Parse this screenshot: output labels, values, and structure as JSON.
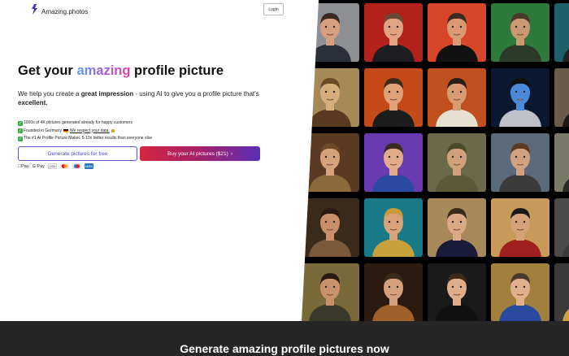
{
  "brand": {
    "name": "Amazing.photos"
  },
  "nav": {
    "login_label": "Login"
  },
  "hero": {
    "headline_before": "Get your ",
    "headline_highlight": "amazing",
    "headline_after": " profile picture",
    "subline_1": "We help you create a ",
    "subline_bold": "great impression",
    "subline_2": " - using AI to give you a profile picture that's ",
    "subline_bold_2": "excellent."
  },
  "bullets": {
    "b1": "1000s of 4K pictures generated already for happy customers",
    "b2_before": "Founded in Germany",
    "b2_link": "We respect your data.",
    "b3": "The #1 AI Profile Picture Maker. 5-10x better results than everyone else"
  },
  "cta": {
    "free_label": "Generate pictures for free",
    "buy_label": "Buy your AI pictures ($21)",
    "buy_arrow": "›"
  },
  "payments": {
    "apple_pay": "Pay",
    "google_pay": "G Pay",
    "visa": "VISA",
    "mastercard": "MC",
    "amex": "AMEX"
  },
  "footer": {
    "title": "Generate amazing profile pictures now"
  },
  "gallery_tiles": [
    {
      "bg": "#8d8f93",
      "skin": "#d6a07e",
      "hair": "#3a2a20",
      "cloth": "#2b2f3a"
    },
    {
      "bg": "#b2221b",
      "skin": "#e0a481",
      "hair": "#6a4a35",
      "cloth": "#1e1e22"
    },
    {
      "bg": "#d8462a",
      "skin": "#d99a73",
      "hair": "#3b2a22",
      "cloth": "#111"
    },
    {
      "bg": "#2e7a3a",
      "skin": "#c99a72",
      "hair": "#4a3a2a",
      "cloth": "#2c3a2a"
    },
    {
      "bg": "#1f5f6a",
      "skin": "#caa081",
      "hair": "#3a2a22",
      "cloth": "#222"
    },
    {
      "bg": "#a58a57",
      "skin": "#d8ad7c",
      "hair": "#6b4a2a",
      "cloth": "#5a3a22"
    },
    {
      "bg": "#c54a1a",
      "skin": "#e0a178",
      "hair": "#3a2a1a",
      "cloth": "#1d1d1d"
    },
    {
      "bg": "#c0501e",
      "skin": "#d99b74",
      "hair": "#2a1e16",
      "cloth": "#e6e0d0"
    },
    {
      "bg": "#0a1832",
      "skin": "#4a8ad8",
      "hair": "#111",
      "cloth": "#c0c0c8"
    },
    {
      "bg": "#6a5a4a",
      "skin": "#d9a684",
      "hair": "#3a2a20",
      "cloth": "#1a1a1a"
    },
    {
      "bg": "#5a3a22",
      "skin": "#d5a27a",
      "hair": "#6b4a2a",
      "cloth": "#8a6a3a"
    },
    {
      "bg": "#6a3ab0",
      "skin": "#e2ac8c",
      "hair": "#3a2a22",
      "cloth": "#2a4aa0"
    },
    {
      "bg": "#6a6a4a",
      "skin": "#cfa07a",
      "hair": "#4a4a2a",
      "cloth": "#5a5a38"
    },
    {
      "bg": "#5a6a7a",
      "skin": "#d0a080",
      "hair": "#5a3a22",
      "cloth": "#3a3a3a"
    },
    {
      "bg": "#7a7a6a",
      "skin": "#d8a882",
      "hair": "#3a2a22",
      "cloth": "#2a2a2a"
    },
    {
      "bg": "#3a2a1a",
      "skin": "#c98f6a",
      "hair": "#2a1a10",
      "cloth": "#7a5a3a"
    },
    {
      "bg": "#1a7a8a",
      "skin": "#d8a27a",
      "hair": "#c89a3a",
      "cloth": "#c8a03a"
    },
    {
      "bg": "#a88a5a",
      "skin": "#d9aa84",
      "hair": "#3a2a1a",
      "cloth": "#1a1a3a"
    },
    {
      "bg": "#c89a5a",
      "skin": "#d5a27a",
      "hair": "#1a1a1a",
      "cloth": "#a02020"
    },
    {
      "bg": "#4a4a4a",
      "skin": "#cf9a74",
      "hair": "#2a1a10",
      "cloth": "#3a3a3a"
    },
    {
      "bg": "#7a6a3a",
      "skin": "#c9926a",
      "hair": "#2a1a10",
      "cloth": "#3a3a2a"
    },
    {
      "bg": "#2a1a10",
      "skin": "#d6a07c",
      "hair": "#3a2a1a",
      "cloth": "#a0602a"
    },
    {
      "bg": "#1a1a1a",
      "skin": "#e0ad8a",
      "hair": "#3a2a1a",
      "cloth": "#101010"
    },
    {
      "bg": "#a0803a",
      "skin": "#e0b08c",
      "hair": "#4a3a2a",
      "cloth": "#2a4aa0"
    },
    {
      "bg": "#3a3a3a",
      "skin": "#d9a07e",
      "hair": "#2a1a10",
      "cloth": "#d0a03a"
    }
  ]
}
